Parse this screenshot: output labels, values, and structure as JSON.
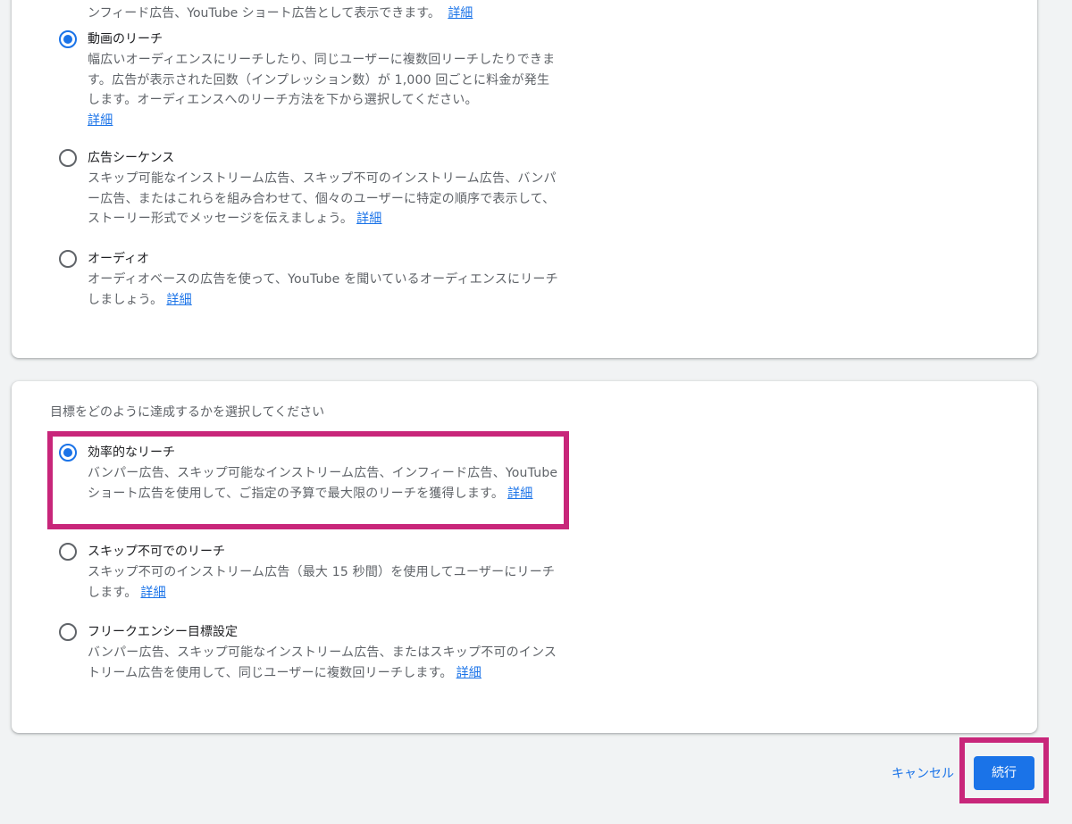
{
  "cut_off_text": "ンフィード広告、YouTube ショート広告として表示できます。",
  "learn_more": "詳細",
  "section1": {
    "options": [
      {
        "title": "動画のリーチ",
        "selected": true,
        "desc": "幅広いオーディエンスにリーチしたり、同じユーザーに複数回リーチしたりできます。広告が表示された回数（インプレッション数）が 1,000 回ごとに料金が発生します。オーディエンスへのリーチ方法を下から選択してください。",
        "link": "詳細"
      },
      {
        "title": "広告シーケンス",
        "selected": false,
        "desc": "スキップ可能なインストリーム広告、スキップ不可のインストリーム広告、バンパー広告、またはこれらを組み合わせて、個々のユーザーに特定の順序で表示して、ストーリー形式でメッセージを伝えましょう。",
        "link": "詳細"
      },
      {
        "title": "オーディオ",
        "selected": false,
        "desc": "オーディオベースの広告を使って、YouTube を聞いているオーディエンスにリーチしましょう。",
        "link": "詳細"
      }
    ]
  },
  "section2": {
    "label": "目標をどのように達成するかを選択してください",
    "options": [
      {
        "title": "効率的なリーチ",
        "selected": true,
        "desc": "バンパー広告、スキップ可能なインストリーム広告、インフィード広告、YouTube ショート広告を使用して、ご指定の予算で最大限のリーチを獲得します。",
        "link": "詳細"
      },
      {
        "title": "スキップ不可でのリーチ",
        "selected": false,
        "desc": "スキップ不可のインストリーム広告（最大 15 秒間）を使用してユーザーにリーチします。",
        "link": "詳細"
      },
      {
        "title": "フリークエンシー目標設定",
        "selected": false,
        "desc": "バンパー広告、スキップ可能なインストリーム広告、またはスキップ不可のインストリーム広告を使用して、同じユーザーに複数回リーチします。",
        "link": "詳細"
      }
    ]
  },
  "actions": {
    "cancel": "キャンセル",
    "continue": "続行"
  },
  "colors": {
    "accent": "#1a73e8",
    "highlight": "#c8267a",
    "background": "#f1f3f4"
  }
}
